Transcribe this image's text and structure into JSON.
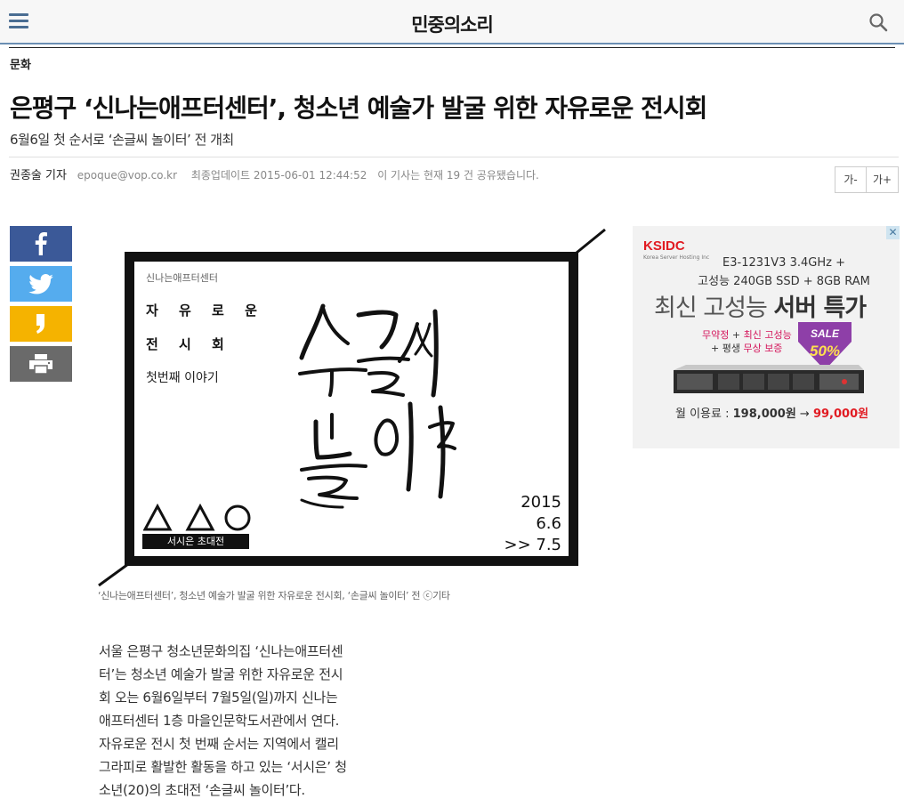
{
  "header": {
    "site_title": "민중의소리"
  },
  "article": {
    "category": "문화",
    "headline": "은평구 ‘신나는애프터센터’, 청소년 예술가 발굴 위한 자유로운 전시회",
    "subhead": "6월6일 첫 순서로 ‘손글씨 놀이터’ 전 개최",
    "author": "권종술 기자",
    "email": "epoque@vop.co.kr",
    "updated": "최종업데이트 2015-06-01 12:44:52",
    "shared": "이 기사는 현재 19 건 공유됐습니다.",
    "font_smaller": "가-",
    "font_larger": "가+",
    "caption": "‘신나는애프터센터’, 청소년 예술가 발굴 위한 자유로운 전시회, ‘손글씨 놀이터’ 전 ⓒ기타",
    "body_lines": [
      "서울 은평구 청소년문화의집 ‘신나는애프터센",
      "터’는 청소년 예술가 발굴 위한 자유로운 전시",
      "회 오는 6월6일부터 7월5일(일)까지 신나는",
      "애프터센터 1층 마을인문학도서관에서 연다.",
      "자유로운 전시 첫 번째 순서는 지역에서 캘리",
      "그라피로 활발한 활동을 하고 있는 ‘서시은’ 청",
      "소년(20)의 초대전 ‘손글씨 놀이터’다."
    ]
  },
  "share": [
    "facebook-icon",
    "twitter-icon",
    "kakaostory-icon",
    "print-icon"
  ],
  "poster": {
    "org": "신나는애프터센터",
    "line1": "자 유 로 운",
    "line2": "전 시 회",
    "line3": "첫번째 이야기",
    "tag": "서시은 초대전",
    "date_year": "2015",
    "date_start": "6.6",
    "date_end": ">> 7.5"
  },
  "ad": {
    "logo": "KSIDC",
    "logo_sub": "Korea Server Hosting Inc",
    "spec1": "E3-1231V3 3.4GHz +",
    "spec2": "고성능 240GB SSD + 8GB RAM",
    "headline_a": "최신 고성능 ",
    "headline_b": "서버 특가",
    "feat1_a": "무약정",
    "feat1_b": " + ",
    "feat1_c": "최신 고성능",
    "feat2_a": "+ 평생 ",
    "feat2_b": "무상 보증",
    "sale_label": "SALE",
    "sale_pct": "50%",
    "price_label": "월 이용료 : ",
    "price_old": "198,000원",
    "price_arrow": " → ",
    "price_new": "99,000원",
    "close": "✕"
  },
  "colors": {
    "header_rule": "#6b8fb3",
    "facebook": "#3b5998",
    "twitter": "#55acee",
    "kakao": "#f5b300",
    "print": "#6a6a6a",
    "ad_red": "#e11b22"
  }
}
